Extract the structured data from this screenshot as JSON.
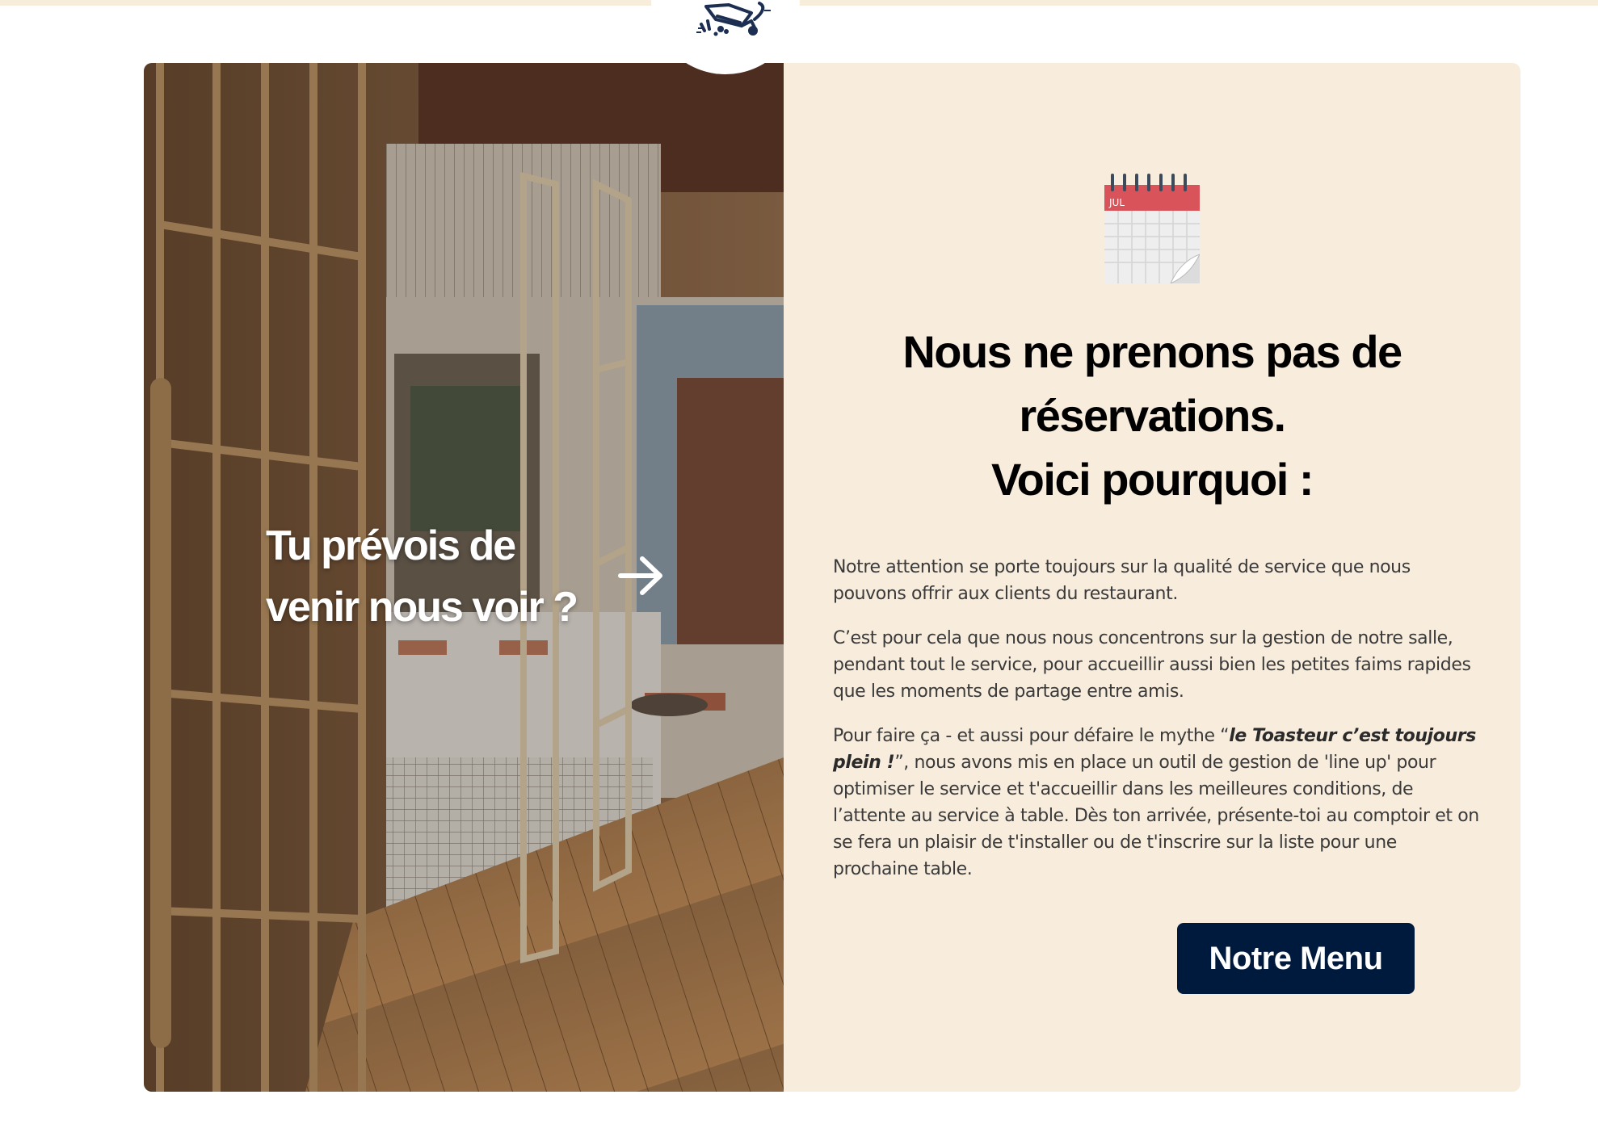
{
  "colors": {
    "page_background": "#ffffff",
    "top_strip": "#f8ecda",
    "panel_background": "#f8ecdc",
    "heading": "#000000",
    "body_text": "#3a3a3a",
    "button_background": "#001a3d",
    "button_text": "#ffffff",
    "calendar_red": "#d9535b"
  },
  "logo": {
    "icon": "toaster-logo-icon"
  },
  "photo_section": {
    "image": "restaurant-entrance-photo",
    "cta_line1": "Tu prévois de",
    "cta_line2": "venir nous voir ?",
    "arrow_icon": "arrow-right-icon"
  },
  "reservations": {
    "calendar_icon": "calendar-icon",
    "calendar_month": "JUL",
    "heading_line1": "Nous ne prenons pas de",
    "heading_line2": "réservations.",
    "heading_line3": "Voici pourquoi :",
    "paragraph1": "Notre attention se porte toujours sur la qualité de service que nous pouvons offrir aux clients du restaurant.",
    "paragraph2": "C’est pour cela que nous nous concentrons sur la gestion de notre salle, pendant tout le service, pour accueillir aussi bien les petites faims rapides que les moments de partage entre amis.",
    "paragraph3_before": "Pour faire ça - et aussi pour défaire le mythe “",
    "paragraph3_emphasis": "le Toasteur c’est toujours plein !",
    "paragraph3_after": "”, nous avons mis en place un outil de gestion de 'line up' pour optimiser le service et t'accueillir dans les meilleures conditions, de l’attente au service à table. Dès ton arrivée, présente-toi au comptoir et on se fera un plaisir de t'installer ou de t'inscrire sur la liste pour une prochaine table.",
    "button_label": "Notre Menu"
  }
}
